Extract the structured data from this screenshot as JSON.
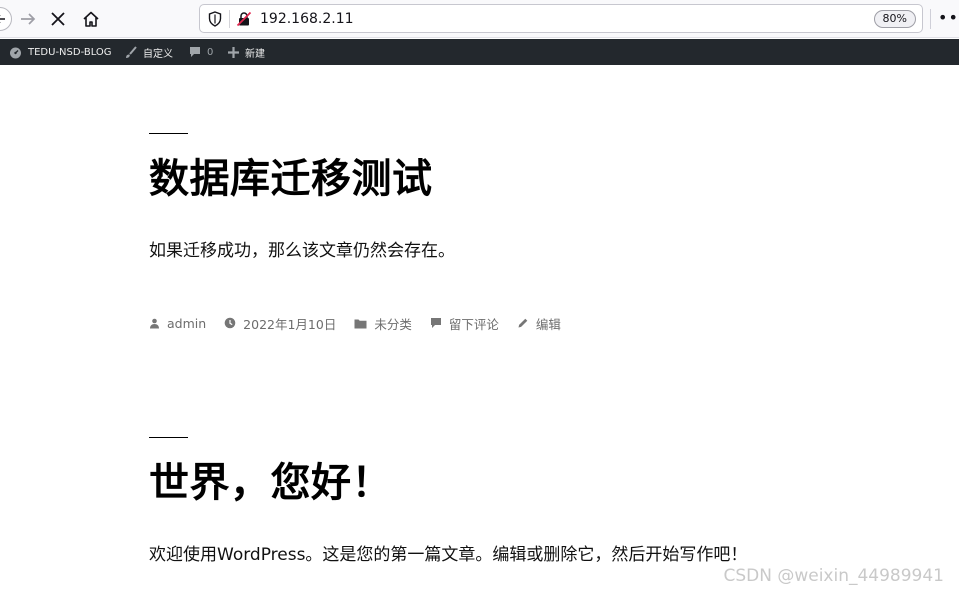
{
  "browser": {
    "url": "192.168.2.11",
    "zoom": "80%",
    "more": "•••"
  },
  "admin_bar": {
    "site_name": "TEDU-NSD-BLOG",
    "customize": "自定义",
    "comments_count": "0",
    "new": "新建"
  },
  "posts": [
    {
      "title": "数据库迁移测试",
      "excerpt": "如果迁移成功，那么该文章仍然会存在。",
      "meta": {
        "author": "admin",
        "date": "2022年1月10日",
        "category": "未分类",
        "comment": "留下评论",
        "edit": "编辑"
      }
    },
    {
      "title": "世界，您好！",
      "excerpt": "欢迎使用WordPress。这是您的第一篇文章。编辑或删除它，然后开始写作吧！"
    }
  ],
  "watermark": "CSDN @weixin_44989941"
}
